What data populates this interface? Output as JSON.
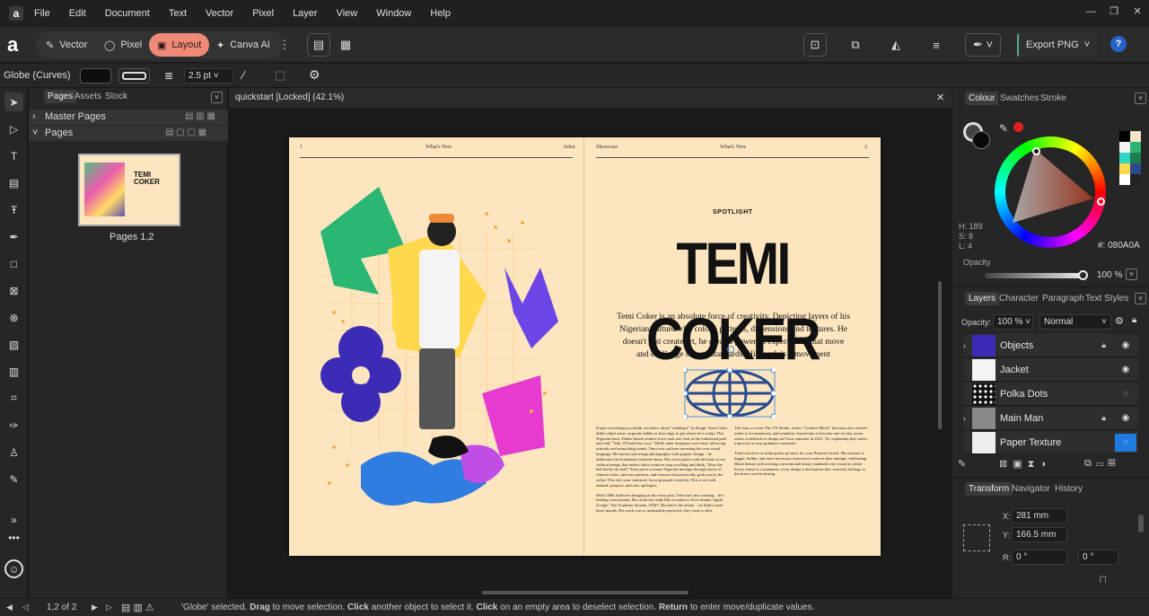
{
  "menu": [
    "File",
    "Edit",
    "Document",
    "Text",
    "Vector",
    "Pixel",
    "Layer",
    "View",
    "Window",
    "Help"
  ],
  "personas": {
    "vector": "Vector",
    "pixel": "Pixel",
    "layout": "Layout",
    "canva": "Canva AI"
  },
  "toolbar": {
    "export_label": "Export PNG"
  },
  "context": {
    "selection_label": "Globe (Curves)",
    "stroke_width": "2.5 pt"
  },
  "pages_panel": {
    "tabs": [
      "Pages",
      "Assets",
      "Stock"
    ],
    "master_pages": "Master Pages",
    "pages": "Pages",
    "thumb_label": "Pages 1,2"
  },
  "document": {
    "tab_title": "quickstart [Locked] (42.1%)"
  },
  "spread": {
    "left_folio": "1",
    "left_header": "What's New",
    "left_header_right": "Artist",
    "right_header_left": "Showcase",
    "right_header": "What's New",
    "right_folio": "2",
    "kicker": "SPOTLIGHT",
    "headline": "TEMI COKER",
    "intro": "Temi Coker is an absolute force of creativity, Depicting layers of his Nigerian culture with colors, patterns, dimensions and textures. He doesn't just create art, he creates powerful experiences that move and challenge beauty standards. His work is a movement",
    "col1a": "Forget everything you think you know about \"making it\" in design. Temi Coker didn't climb some corporate ladder or kiss rings to get where he is today. This Nigerian-born, Dallas-based creative force took one look at the traditional path and said, \"Nah, I'll build my own.\" While other designers were busy following tutorials and mimicking trends, Temi was out here inventing his own visual language. He doesn't just merge photography with graphic design – he obliterates the boundaries between them. His work pulses with the kind of raw cultural energy that makes other creatives stop scrolling and think, \"How the hell did he do that?\" Each piece screams Nigerian heritage through layers of vibrant colors, intricate patterns, and textures that practically grab you by the collar. This isn't your sanitized, focus-grouped creativity. This is art with attitude, purpose, and zero apologies.",
    "col1b": "With 136K followers hanging on his every post, Temi isn't just creating – he's leading a movement. His client list reads like a creative's fever dream: Apple, Google, The Academy Awards, AT&T. But here's the kicker – he didn't chase these brands. His work was so undeniably powerful, they came to him.",
    "col2a": "The man co-owns The TX Studio, writes \"Creative Block\" (because one creative outlet is for amateurs), and somehow found time to become one of only seven artists worldwide to design an Oscar statuette in 2021. Try explaining that career trajectory to your guidance counselor.",
    "col2b": "Temi's not here to make pretty pictures for your Pinterest board. His mission is bigger, bolder, and more necessary than most creatives dare attempt: celebrating Black beauty and torching conventional beauty standards one visual at a time. Every frame is a statement, every design a declaration that creativity belongs to the brave, not the boring."
  },
  "colour_panel": {
    "tabs": [
      "Colour",
      "Swatches",
      "Stroke"
    ],
    "h": "H: 189",
    "s": "S: 8",
    "l": "L: 4",
    "hex": "#: 080A0A",
    "opacity_label": "Opacity",
    "opacity_value": "100 %"
  },
  "layers_panel": {
    "tabs": [
      "Layers",
      "Character",
      "Paragraph",
      "Text Styles"
    ],
    "opacity_label": "Opacity:",
    "opacity_value": "100 %",
    "blend": "Normal",
    "layers": [
      {
        "name": "Objects",
        "locked": true
      },
      {
        "name": "Jacket",
        "locked": false
      },
      {
        "name": "Polka Dots",
        "locked": false
      },
      {
        "name": "Main Man",
        "locked": true
      },
      {
        "name": "Paper Texture",
        "locked": false
      }
    ]
  },
  "transform_panel": {
    "tabs": [
      "Transform",
      "Navigator",
      "History"
    ],
    "x_label": "X:",
    "x": "281 mm",
    "y_label": "Y:",
    "y": "166.5 mm",
    "r_label": "R:",
    "r": "0 °",
    "s": "0 °"
  },
  "status": {
    "pages": "1,2 of 2",
    "message_parts": [
      "'Globe' selected. ",
      "Drag",
      " to move selection. ",
      "Click",
      " another object to select it. ",
      "Click",
      " on an empty area to deselect selection. ",
      "Return",
      " to enter move/duplicate values."
    ]
  },
  "colors": {
    "accent": "#f08a78",
    "paper": "#fde6bf",
    "selection": "#4a90e2",
    "export_btn": "#2a2a2a"
  }
}
